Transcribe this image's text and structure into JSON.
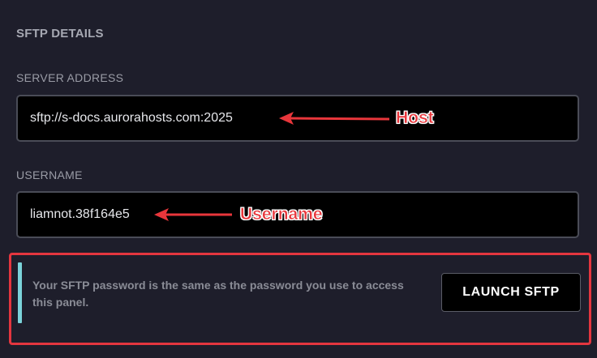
{
  "section": {
    "title": "SFTP DETAILS"
  },
  "server_address": {
    "label": "SERVER ADDRESS",
    "value": "sftp://s-docs.aurorahosts.com:2025"
  },
  "username": {
    "label": "USERNAME",
    "value": "liamnot.38f164e5"
  },
  "annotations": {
    "host": "Host",
    "username": "Username",
    "color": "#e8363b"
  },
  "info": {
    "message": "Your SFTP password is the same as the password you use to access this panel.",
    "bar_color": "#7bd3da"
  },
  "launch_button": {
    "label": "LAUNCH SFTP"
  }
}
